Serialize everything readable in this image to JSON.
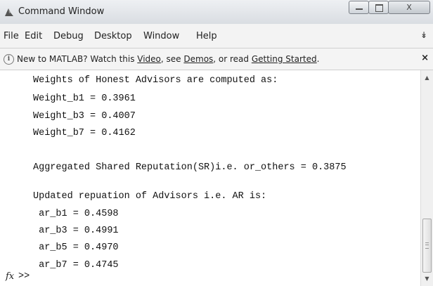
{
  "window": {
    "title": "Command Window",
    "icon": "matlab-logo-icon",
    "controls": {
      "minimize_icon": "minimize-icon",
      "maximize_icon": "maximize-icon",
      "close_label": "X"
    }
  },
  "menu": {
    "items": [
      "File",
      "Edit",
      "Debug",
      "Desktop",
      "Window",
      "Help"
    ],
    "overflow_icon": "chevron-double-down-icon"
  },
  "infobar": {
    "icon_label": "i",
    "prefix": "New to MATLAB? Watch this ",
    "link_video": "Video",
    "mid1": ", see ",
    "link_demos": "Demos",
    "mid2": ", or read ",
    "link_getting_started": "Getting Started",
    "suffix": ".",
    "close_label": "×"
  },
  "console": {
    "lines": [
      "Weights of Honest Advisors are computed as:",
      "Weight_b1 = 0.3961",
      "Weight_b3 = 0.4007",
      "Weight_b7 = 0.4162",
      "",
      "Aggregated Shared Reputation(SR)i.e. or_others = 0.3875",
      "",
      "Updated repuation of Advisors i.e. AR is:",
      " ar_b1 = 0.4598",
      " ar_b3 = 0.4991",
      " ar_b5 = 0.4970",
      " ar_b7 = 0.4745"
    ],
    "fx_label": "fx",
    "prompt": ">>"
  },
  "scrollbar": {
    "up_icon": "triangle-up-icon",
    "down_icon": "triangle-down-icon",
    "position": 0.78
  },
  "colors": {
    "titlebar": "#dfe3e8",
    "menubar": "#f3f3f3",
    "console_bg": "#ffffff",
    "text": "#111111"
  }
}
